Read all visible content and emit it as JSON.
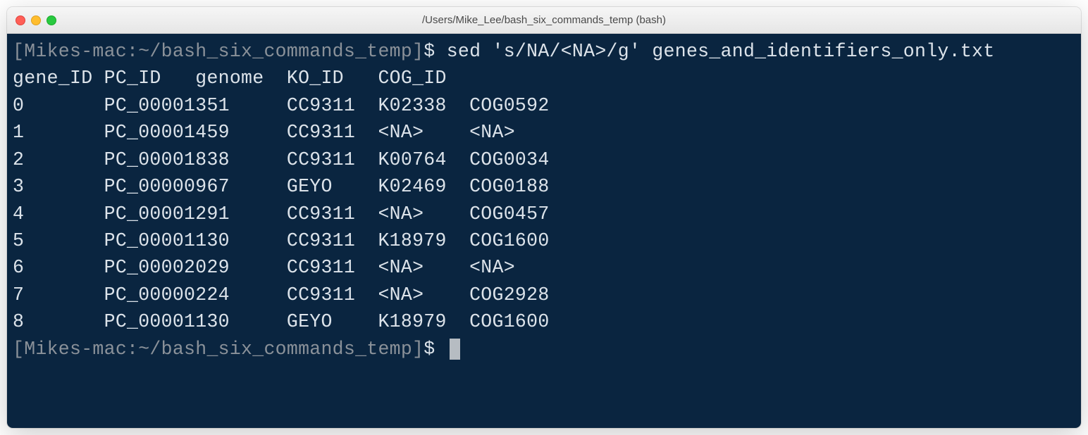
{
  "window": {
    "title": "/Users/Mike_Lee/bash_six_commands_temp (bash)"
  },
  "prompt": {
    "host_path": "[Mikes-mac:~/bash_six_commands_temp]",
    "symbol": "$"
  },
  "command": {
    "text": "sed 's/NA/<NA>/g' genes_and_identifiers_only.txt"
  },
  "output": {
    "header": "gene_ID PC_ID   genome  KO_ID   COG_ID",
    "rows": [
      "0       PC_00001351     CC9311  K02338  COG0592",
      "1       PC_00001459     CC9311  <NA>    <NA>",
      "2       PC_00001838     CC9311  K00764  COG0034",
      "3       PC_00000967     GEYO    K02469  COG0188",
      "4       PC_00001291     CC9311  <NA>    COG0457",
      "5       PC_00001130     CC9311  K18979  COG1600",
      "6       PC_00002029     CC9311  <NA>    <NA>",
      "7       PC_00000224     CC9311  <NA>    COG2928",
      "8       PC_00001130     GEYO    K18979  COG1600"
    ]
  }
}
